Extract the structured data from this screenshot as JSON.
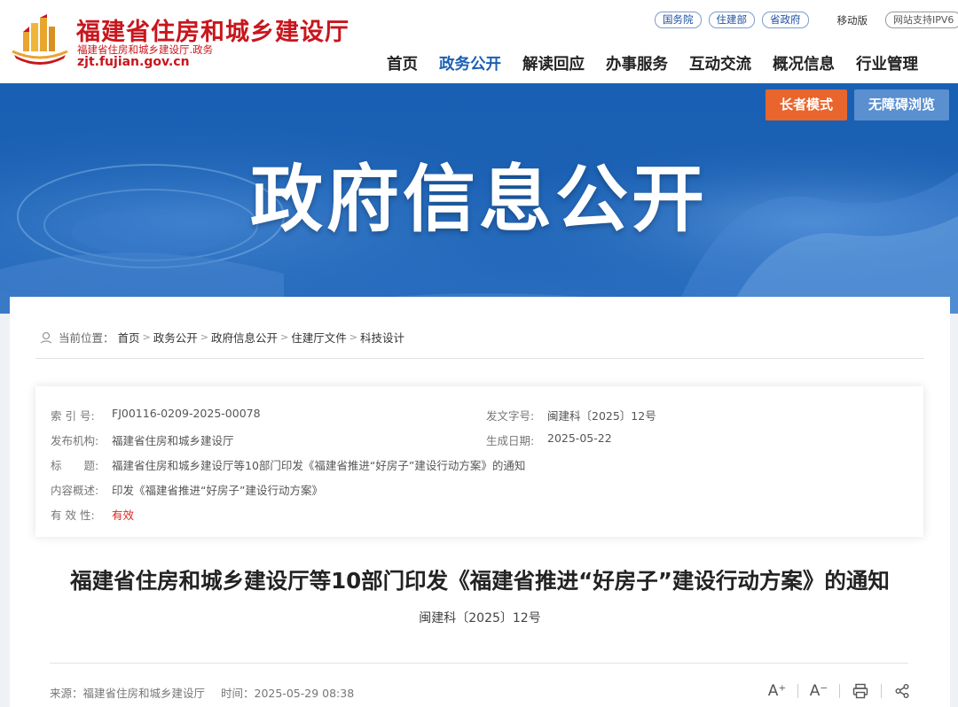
{
  "header": {
    "site_name": "福建省住房和城乡建设厅",
    "site_sub": "福建省住房和城乡建设厅.政务",
    "site_domain": "zjt.fujian.gov.cn",
    "top_links": [
      "国务院",
      "住建部",
      "省政府"
    ],
    "mobile_label": "移动版",
    "ipv6_label": "网站支持IPV6",
    "nav": [
      {
        "label": "首页",
        "active": false
      },
      {
        "label": "政务公开",
        "active": true
      },
      {
        "label": "解读回应",
        "active": false
      },
      {
        "label": "办事服务",
        "active": false
      },
      {
        "label": "互动交流",
        "active": false
      },
      {
        "label": "概况信息",
        "active": false
      },
      {
        "label": "行业管理",
        "active": false
      }
    ]
  },
  "banner": {
    "title": "政府信息公开",
    "elder_mode": "长者模式",
    "accessible": "无障碍浏览"
  },
  "breadcrumb": {
    "prefix": "当前位置：",
    "items": [
      "首页",
      "政务公开",
      "政府信息公开",
      "住建厅文件",
      "科技设计"
    ],
    "separator": ">"
  },
  "meta": {
    "index_label": "索 引 号:",
    "index_value": "FJ00116-0209-2025-00078",
    "doc_no_label": "发文字号:",
    "doc_no_value": "闽建科〔2025〕12号",
    "issuer_label": "发布机构:",
    "issuer_value": "福建省住房和城乡建设厅",
    "date_label": "生成日期:",
    "date_value": "2025-05-22",
    "title_label": "标　　题:",
    "title_value": "福建省住房和城乡建设厅等10部门印发《福建省推进“好房子”建设行动方案》的通知",
    "summary_label": "内容概述:",
    "summary_value": "印发《福建省推进“好房子”建设行动方案》",
    "validity_label": "有 效 性:",
    "validity_value": "有效"
  },
  "document": {
    "title": "福建省住房和城乡建设厅等10部门印发《福建省推进“好房子”建设行动方案》的通知",
    "number": "闽建科〔2025〕12号",
    "source": "来源：福建省住房和城乡建设厅",
    "time": "时间：2025-05-29 08:38"
  },
  "tools": {
    "font_up": "A⁺",
    "font_down": "A⁻"
  },
  "colors": {
    "brand_red": "#c8161d",
    "nav_active": "#1b5fb4",
    "banner_blue": "#1960b4",
    "elder_orange": "#e8662d",
    "access_blue": "#5a8fd0",
    "valid_red": "#e0251b"
  }
}
